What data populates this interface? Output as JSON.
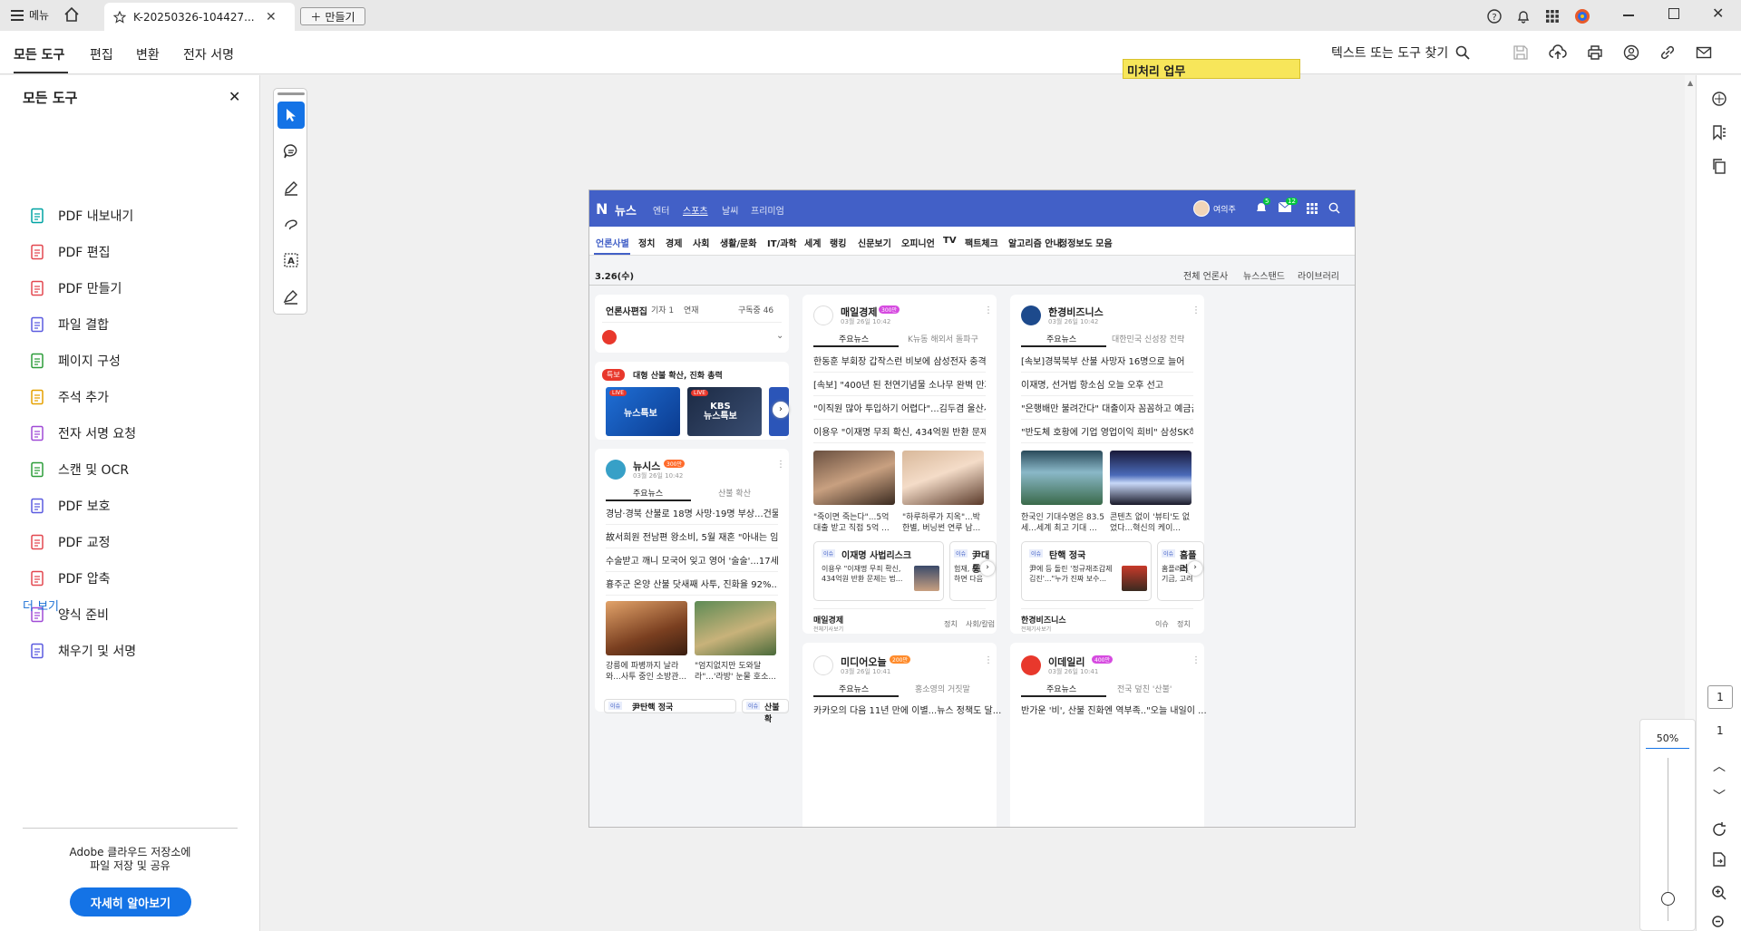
{
  "titlebar": {
    "menu_label": "메뉴",
    "tab_title": "K-20250326-104427...",
    "new_button": "만들기"
  },
  "menubar": {
    "items": [
      "모든 도구",
      "편집",
      "변환",
      "전자 서명"
    ],
    "search_label": "텍스트 또는 도구 찾기",
    "sticky_note": "미처리 업무"
  },
  "leftpanel": {
    "title": "모든 도구",
    "tools": [
      {
        "label": "PDF 내보내기",
        "icon": "export-pdf-icon",
        "color": "#00a3a3"
      },
      {
        "label": "PDF 편집",
        "icon": "edit-pdf-icon",
        "color": "#e34850"
      },
      {
        "label": "PDF 만들기",
        "icon": "create-pdf-icon",
        "color": "#e34850"
      },
      {
        "label": "파일 결합",
        "icon": "combine-files-icon",
        "color": "#5c5ce0"
      },
      {
        "label": "페이지 구성",
        "icon": "organize-pages-icon",
        "color": "#2d9d3a"
      },
      {
        "label": "주석 추가",
        "icon": "comment-icon",
        "color": "#e6a100"
      },
      {
        "label": "전자 서명 요청",
        "icon": "request-signature-icon",
        "color": "#a04bd6"
      },
      {
        "label": "스캔 및 OCR",
        "icon": "scan-ocr-icon",
        "color": "#2d9d3a"
      },
      {
        "label": "PDF 보호",
        "icon": "protect-pdf-icon",
        "color": "#5c5ce0"
      },
      {
        "label": "PDF 교정",
        "icon": "redact-pdf-icon",
        "color": "#e34850"
      },
      {
        "label": "PDF 압축",
        "icon": "compress-pdf-icon",
        "color": "#e34850"
      },
      {
        "label": "양식 준비",
        "icon": "prepare-form-icon",
        "color": "#a04bd6"
      },
      {
        "label": "채우기 및 서명",
        "icon": "fill-sign-icon",
        "color": "#5c5ce0"
      }
    ],
    "more": "더 보기",
    "cloud_text_1": "Adobe 클라우드 저장소에",
    "cloud_text_2": "파일 저장 및 공유",
    "cloud_button": "자세히 알아보기"
  },
  "zoom": {
    "level": "50%",
    "page_input": "1",
    "page_total": "1"
  },
  "naver": {
    "logo": "뉴스",
    "top_links": [
      "엔터",
      "스포츠",
      "날씨",
      "프리미엄"
    ],
    "user": "여의주",
    "bell_count": "5",
    "mail_count": "12",
    "nav": [
      "언론사별",
      "정치",
      "경제",
      "사회",
      "생활/문화",
      "IT/과학",
      "세계",
      "랭킹",
      "신문보기",
      "오피니언",
      "TV",
      "팩트체크",
      "알고리즘 안내",
      "정정보도 모음"
    ],
    "date": "3.26(수)",
    "date_links": [
      "전체 언론사",
      "뉴스스탠드",
      "라이브러리"
    ],
    "edit_card": {
      "title": "언론사편집",
      "filter1": "기자 1",
      "filter2": "연재",
      "subscribe": "구독중 46"
    },
    "live": {
      "badge": "특보",
      "title": "대형 산불 확산, 진화 총력",
      "live_label": "LIVE",
      "tile1": "뉴스특보",
      "tile2": "KBS\n뉴스특보"
    },
    "newsis": {
      "name": "뉴시스",
      "badge": "300만",
      "time": "03월 26일 10:42",
      "tab1": "주요뉴스",
      "tab2": "산불 확산",
      "lines": [
        "경남·경북 산불로 18명 사망·19명 부상...건물 20...",
        "故서희원 전남편 왕소비, 5월 재혼 \"아내는 임신...",
        "수술받고 깨니 모국어 잊고 영어 '술술'...17세 ...",
        "흉주군 온양 산불 닷새째 사투, 진화율 92%...인..."
      ],
      "caption1": "강릉에 파병까지 날라와...사투 중인 소방관...",
      "caption2": "\"엄지없지만 도와달라\"...'라방' 눈물 호소...",
      "issue": "尹탄핵 정국",
      "issue2": "산불 확"
    },
    "maeil": {
      "name": "매일경제",
      "badge": "300만",
      "time": "03월 26일 10:42",
      "tab1": "주요뉴스",
      "tab2": "K뉴동 해외서 돌파구",
      "lines": [
        "한동훈 부회장 갑작스런 비보에 삼성전자 충격...",
        "[속보] \"400년 된 천연기념물 소나무 완벽 만지...",
        "\"이직원 많아 투입하기 어렵다\"...김두겸 울산시...",
        "이용우 \"이재명 무죄 확신, 434억원 반환 문제는..."
      ],
      "caption1": "\"죽이면 죽는다\"...5억 대출 받고 직접 5억 ...",
      "caption2": "\"하루하루가 지옥\"...박 한별, 버닝썬 연루 남...",
      "issue": "이재명 사법리스크",
      "issue_text": "이용우 \"이재명 무죄 확신, 434억원 반환 문제는 법...",
      "issue2": "尹대통",
      "issue2_text": "험재, 오늘 안하면 다음",
      "footer": "매일경제",
      "footer_sub": "전체기사보기",
      "footer_links": [
        "정치",
        "사회/칼럼"
      ]
    },
    "hankyung": {
      "name": "한경비즈니스",
      "time": "03월 26일 10:42",
      "tab1": "주요뉴스",
      "tab2": "대한민국 신성장 전략",
      "lines": [
        "[속보]경북북부 산불 사망자 16명으로 늘어",
        "이재명, 선거법 항소심 오늘 오후 선고",
        "\"은행배만 불려간다\" 대출이자 꼼꼼하고 예금금...",
        "\"반도체 호황에 기업 영업이익 희비\" 삼성SK하..."
      ],
      "caption1": "한국인 기대수명은 83.5세...세계 최고 기대 ...",
      "caption2": "콘텐츠 없이 '뷰티'도 없었다...혁신의 케이...",
      "issue": "탄핵 정국",
      "issue_text": "尹에 등 돌린 '정규재조갑제 김진'...\"누가 진짜 보수...",
      "issue2": "홈플러",
      "issue2_text": "홈플러스, 연기금, 고려",
      "footer": "한경비즈니스",
      "footer_sub": "전체기사보기",
      "footer_links": [
        "이슈",
        "정치"
      ]
    },
    "mediaoneul": {
      "name": "미디어오늘",
      "badge": "200만",
      "time": "03월 26일 10:41",
      "tab1": "주요뉴스",
      "tab2": "홍소영의 거짓말",
      "line": "카카오의 다음 11년 만에 이별...뉴스 정책도 달..."
    },
    "edaily": {
      "name": "이데일리",
      "badge": "400만",
      "time": "03월 26일 10:41",
      "tab1": "주요뉴스",
      "tab2": "전국 덮친 '산불'",
      "line": "반가운 '비', 산불 진화엔 역부족..\"오늘 내일이 ..."
    }
  }
}
